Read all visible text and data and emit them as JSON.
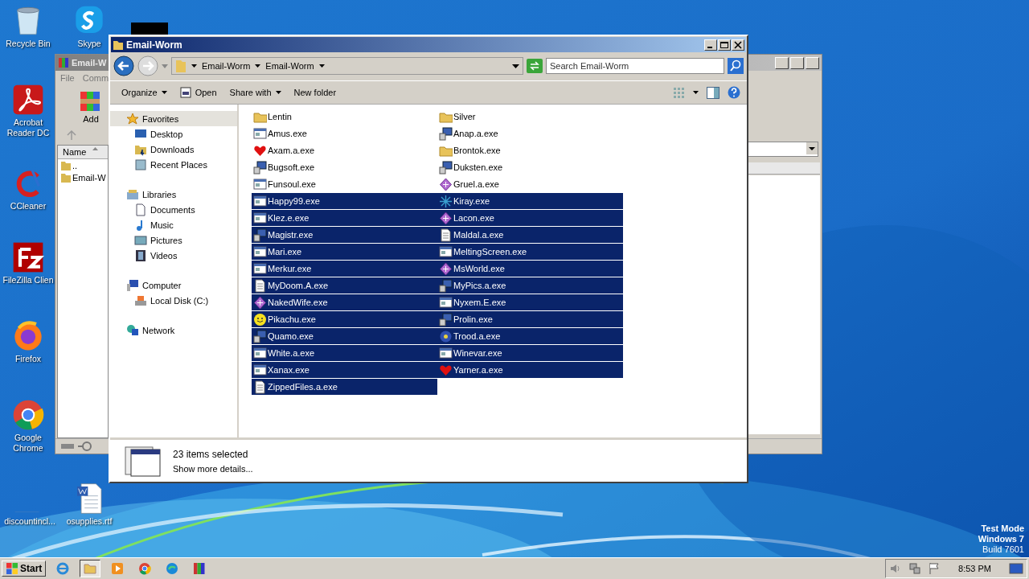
{
  "desktop_icons": [
    {
      "label": "Recycle Bin",
      "kind": "bin"
    },
    {
      "label": "Acrobat Reader DC",
      "kind": "acrobat"
    },
    {
      "label": "CCleaner",
      "kind": "ccleaner"
    },
    {
      "label": "FileZilla Clien",
      "kind": "filezilla"
    },
    {
      "label": "Firefox",
      "kind": "firefox"
    },
    {
      "label": "Google Chrome",
      "kind": "chrome"
    },
    {
      "label": "discountincl...",
      "kind": "blank"
    },
    {
      "label": "Skype",
      "kind": "skype"
    },
    {
      "label": "osupplies.rtf",
      "kind": "document"
    }
  ],
  "os_notice": [
    "Test Mode",
    "Windows 7",
    "Build 7601"
  ],
  "archive_window": {
    "title": "Email-W",
    "menu": [
      "File",
      "Comm"
    ],
    "toolbar": [
      "Add"
    ],
    "columns": [
      "Name"
    ],
    "rows": [
      "..",
      "Email-W"
    ]
  },
  "explorer": {
    "title": "Email-Worm",
    "breadcrumb": [
      "Email-Worm",
      "Email-Worm"
    ],
    "search": {
      "placeholder": "Search Email-Worm"
    },
    "toolbar": [
      {
        "label": "Organize",
        "dropdown": true
      },
      {
        "label": "Open",
        "dropdown": false
      },
      {
        "label": "Share with",
        "dropdown": true
      },
      {
        "label": "New folder",
        "dropdown": false
      }
    ],
    "nav": [
      {
        "label": "Favorites",
        "selected": true,
        "children": [
          {
            "label": "Desktop",
            "selected": false
          },
          {
            "label": "Downloads",
            "selected": false
          },
          {
            "label": "Recent Places",
            "selected": false
          }
        ]
      },
      {
        "label": "Libraries",
        "selected": false,
        "children": [
          {
            "label": "Documents",
            "selected": false
          },
          {
            "label": "Music",
            "selected": false
          },
          {
            "label": "Pictures",
            "selected": false
          },
          {
            "label": "Videos",
            "selected": false
          }
        ]
      },
      {
        "label": "Computer",
        "selected": false,
        "children": [
          {
            "label": "Local Disk (C:)",
            "selected": false
          }
        ]
      },
      {
        "label": "Network",
        "selected": false
      }
    ],
    "files": [
      {
        "name": "Lentin",
        "kind": "folder",
        "selected": false
      },
      {
        "name": "Amus.exe",
        "kind": "file",
        "selected": false
      },
      {
        "name": "Axam.a.exe",
        "kind": "file",
        "selected": false
      },
      {
        "name": "Bugsoft.exe",
        "kind": "file",
        "selected": false
      },
      {
        "name": "Funsoul.exe",
        "kind": "file",
        "selected": false
      },
      {
        "name": "Happy99.exe",
        "kind": "file",
        "selected": true
      },
      {
        "name": "Klez.e.exe",
        "kind": "file",
        "selected": true
      },
      {
        "name": "Magistr.exe",
        "kind": "file",
        "selected": true
      },
      {
        "name": "Mari.exe",
        "kind": "file",
        "selected": true
      },
      {
        "name": "Merkur.exe",
        "kind": "file",
        "selected": true
      },
      {
        "name": "MyDoom.A.exe",
        "kind": "file",
        "selected": true
      },
      {
        "name": "NakedWife.exe",
        "kind": "file",
        "selected": true
      },
      {
        "name": "Pikachu.exe",
        "kind": "file",
        "selected": true
      },
      {
        "name": "Quamo.exe",
        "kind": "file",
        "selected": true
      },
      {
        "name": "White.a.exe",
        "kind": "file",
        "selected": true
      },
      {
        "name": "Xanax.exe",
        "kind": "file",
        "selected": true
      },
      {
        "name": "ZippedFiles.a.exe",
        "kind": "file",
        "selected": true
      },
      {
        "name": "Silver",
        "kind": "folder",
        "selected": false
      },
      {
        "name": "Anap.a.exe",
        "kind": "file",
        "selected": false
      },
      {
        "name": "Brontok.exe",
        "kind": "folder",
        "selected": false
      },
      {
        "name": "Duksten.exe",
        "kind": "file",
        "selected": false
      },
      {
        "name": "Gruel.a.exe",
        "kind": "file",
        "selected": false
      },
      {
        "name": "Kiray.exe",
        "kind": "file",
        "selected": true
      },
      {
        "name": "Lacon.exe",
        "kind": "file",
        "selected": true
      },
      {
        "name": "Maldal.a.exe",
        "kind": "file",
        "selected": true
      },
      {
        "name": "MeltingScreen.exe",
        "kind": "file",
        "selected": true
      },
      {
        "name": "MsWorld.exe",
        "kind": "file",
        "selected": true
      },
      {
        "name": "MyPics.a.exe",
        "kind": "file",
        "selected": true
      },
      {
        "name": "Nyxem.E.exe",
        "kind": "file",
        "selected": true
      },
      {
        "name": "Prolin.exe",
        "kind": "file",
        "selected": true
      },
      {
        "name": "Trood.a.exe",
        "kind": "file",
        "selected": true
      },
      {
        "name": "Winevar.exe",
        "kind": "file",
        "selected": true
      },
      {
        "name": "Yarner.a.exe",
        "kind": "file",
        "selected": true
      }
    ],
    "status": {
      "count": "23 items selected",
      "details": "Show more details..."
    }
  },
  "taskbar": {
    "start": "Start",
    "pinned": [
      {
        "kind": "ie",
        "selected": false
      },
      {
        "kind": "folder",
        "selected": true
      },
      {
        "kind": "media",
        "selected": false
      },
      {
        "kind": "chrome",
        "selected": false
      },
      {
        "kind": "edge",
        "selected": false
      },
      {
        "kind": "archive",
        "selected": false
      }
    ],
    "time": "8:53 PM"
  }
}
